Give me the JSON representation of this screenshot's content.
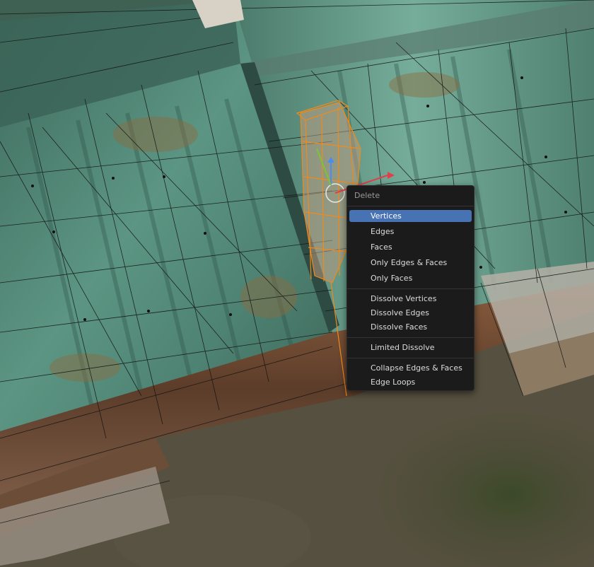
{
  "viewport": {
    "colors": {
      "roof": "#4f7f6f",
      "roof_light": "#6fa592",
      "rust": "#8a6a3c",
      "wall_wood": "#6b4a33",
      "ground": "#56513f",
      "grass": "#3f4a2b",
      "wire": "#141414",
      "selection": "#f08a1c"
    }
  },
  "delete_menu": {
    "title": "Delete",
    "items": [
      {
        "label": "Vertices",
        "active": true
      },
      {
        "label": "Edges"
      },
      {
        "label": "Faces"
      },
      {
        "label": "Only Edges & Faces"
      },
      {
        "label": "Only Faces"
      },
      {
        "label": "Dissolve Vertices"
      },
      {
        "label": "Dissolve Edges"
      },
      {
        "label": "Dissolve Faces"
      },
      {
        "label": "Limited Dissolve"
      },
      {
        "label": "Collapse Edges & Faces"
      },
      {
        "label": "Edge Loops"
      }
    ]
  }
}
